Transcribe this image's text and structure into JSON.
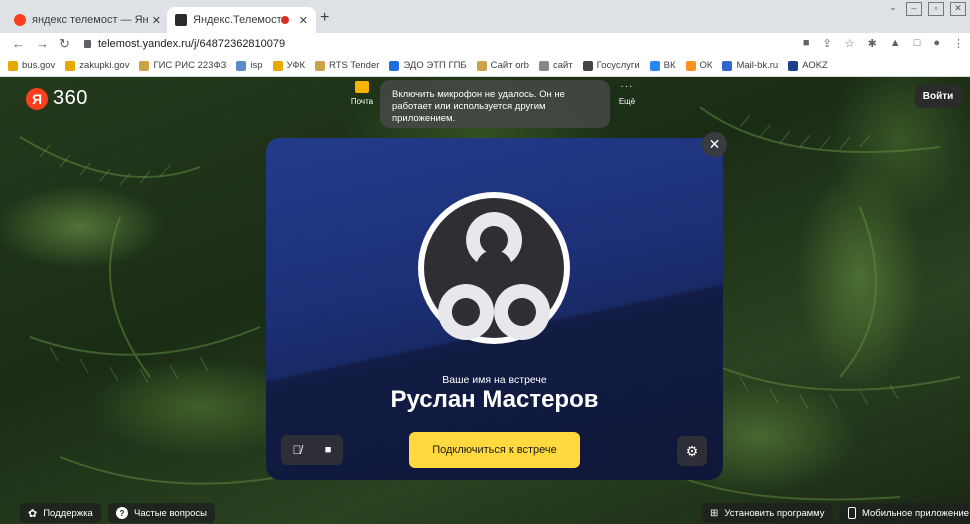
{
  "tabs": [
    {
      "title": "яндекс телемост — Яндекс: нашл",
      "close": "✕",
      "favicon_color": "#fc3f1d"
    },
    {
      "title": "Яндекс.Телемост",
      "close": "✕",
      "favicon_color": "#2b2b2b"
    }
  ],
  "new_tab": "+",
  "address_bar": {
    "url": "telemost.yandex.ru/j/64872362810079"
  },
  "bookmarks": [
    {
      "label": "bus.gov",
      "color": "#e6a700"
    },
    {
      "label": "zakupki.gov",
      "color": "#e6a700"
    },
    {
      "label": "ГИС РИС 223ФЗ",
      "color": "#c9a24a"
    },
    {
      "label": "isp",
      "color": "#5b8ac9"
    },
    {
      "label": "УФК",
      "color": "#e6a700"
    },
    {
      "label": "RTS Tender",
      "color": "#c9a24a"
    },
    {
      "label": "ЭДО ЭТП ГПБ",
      "color": "#1e6fd9"
    },
    {
      "label": "Сайт orb",
      "color": "#c9a24a"
    },
    {
      "label": "сайт",
      "color": "#888888"
    },
    {
      "label": "Госуслуги",
      "color": "#444444"
    },
    {
      "label": "ВК",
      "color": "#2787f5"
    },
    {
      "label": "ОК",
      "color": "#f7931e"
    },
    {
      "label": "Mail-bk.ru",
      "color": "#3366cc"
    },
    {
      "label": "АОKZ",
      "color": "#1b3f8a"
    }
  ],
  "header": {
    "logo_letter": "Я",
    "logo_text": "360",
    "mail_label": "Почта",
    "more_label": "Ещё",
    "more_dots": "···",
    "login_label": "Войти"
  },
  "toast": {
    "message": "Включить микрофон не удалось. Он не работает или используется другим приложением."
  },
  "card": {
    "name_label": "Ваше имя на встрече",
    "name_value": "Руслан Мастеров",
    "join_label": "Подключиться к встрече",
    "close_glyph": "✕"
  },
  "footer": {
    "support_label": "Поддержка",
    "faq_label": "Частые вопросы",
    "install_label": "Установить программу",
    "mobile_label": "Мобильное приложение"
  },
  "colors": {
    "accent_yellow": "#ffd93d",
    "yandex_red": "#fc3f1d",
    "card_blue": "#1d3078"
  }
}
